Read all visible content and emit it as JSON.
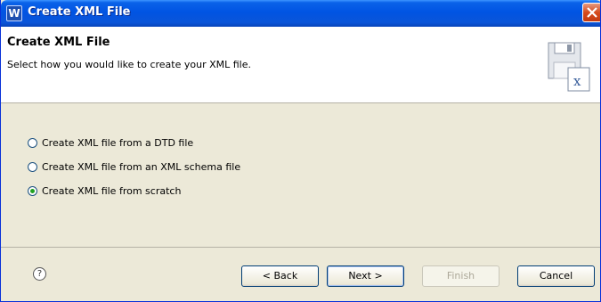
{
  "window": {
    "title": "Create XML File",
    "app_icon_letter": "W"
  },
  "header": {
    "title": "Create XML File",
    "description": "Select how you would like to create your XML file."
  },
  "options": [
    {
      "label": "Create XML file from a DTD file",
      "selected": false
    },
    {
      "label": "Create XML file from an XML schema file",
      "selected": false
    },
    {
      "label": "Create XML file from scratch",
      "selected": true
    }
  ],
  "footer": {
    "help_glyph": "?",
    "back_label": "< Back",
    "next_label": "Next >",
    "finish_label": "Finish",
    "cancel_label": "Cancel"
  }
}
